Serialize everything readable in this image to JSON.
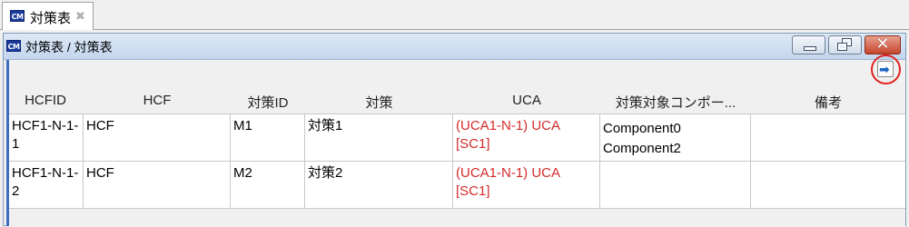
{
  "tab": {
    "icon": "cm-app-icon",
    "title": "対策表",
    "close": "✖"
  },
  "window": {
    "title": "対策表 / 対策表",
    "controls": {
      "minimize": "minimize",
      "maximize": "restore",
      "close": "✕"
    }
  },
  "toolbar": {
    "export_icon": "export-arrow-icon",
    "export_glyph": "➡"
  },
  "table": {
    "columns": [
      "HCFID",
      "HCF",
      "対策ID",
      "対策",
      "UCA",
      "対策対象コンポー...",
      "備考"
    ],
    "rows": [
      {
        "hcfid": "HCF1-N-1-1",
        "hcf": "HCF",
        "measure_id": "M1",
        "measure": "対策1",
        "uca": "(UCA1-N-1) UCA [SC1]",
        "components": [
          "Component0",
          "Component2"
        ],
        "note": ""
      },
      {
        "hcfid": "HCF1-N-1-2",
        "hcf": "HCF",
        "measure_id": "M2",
        "measure": "対策2",
        "uca": "(UCA1-N-1) UCA [SC1]",
        "components": [],
        "note": ""
      }
    ]
  },
  "colors": {
    "uca_text": "#d42a2a",
    "highlight": "#e02020",
    "titlebar": "#c4d6ee"
  }
}
